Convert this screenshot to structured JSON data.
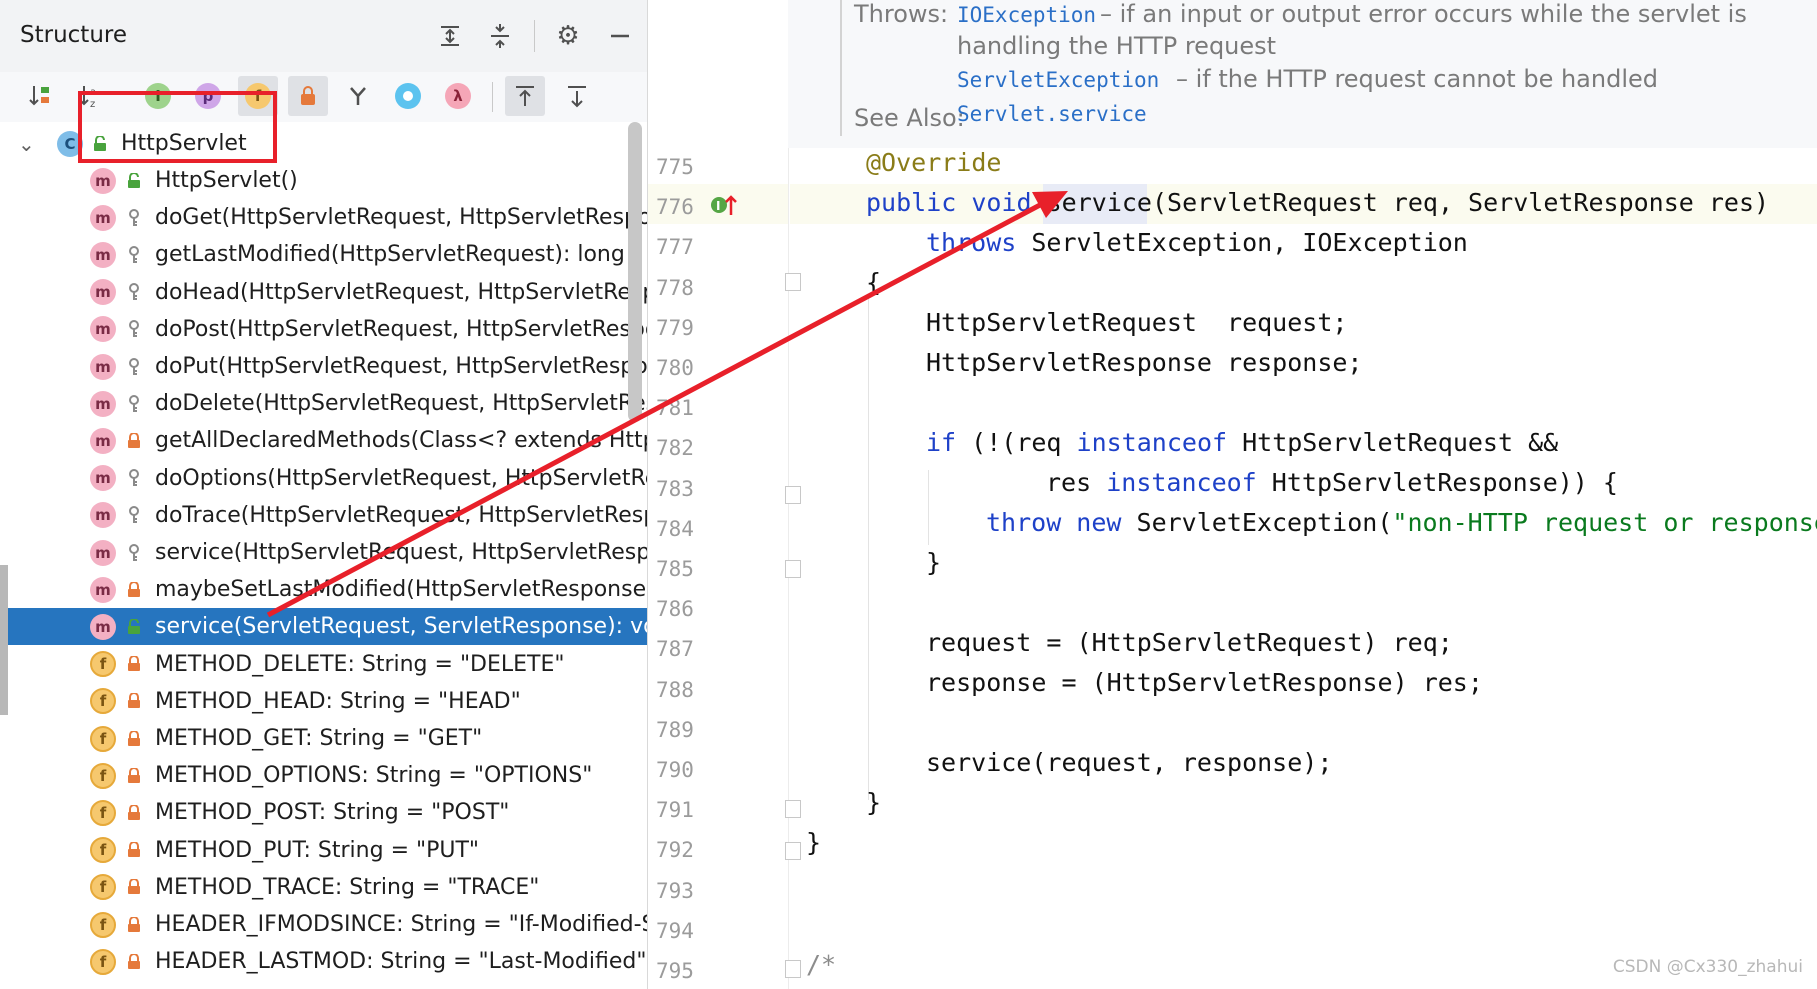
{
  "structure": {
    "title": "Structure",
    "header_icons": [
      "expand-all-icon",
      "collapse-all-icon",
      "gear-icon",
      "minimize-icon"
    ],
    "toolbar_icons": [
      "sort-by-visibility-icon",
      "sort-alphabetically-icon",
      "show-inherited-icon",
      "show-properties-icon",
      "show-fields-icon",
      "show-non-public-icon",
      "show-anonymous-icon",
      "show-lambdas-icon",
      "lambda-icon",
      "autoscroll-to-source-icon",
      "autoscroll-from-source-icon"
    ],
    "root": {
      "label": "HttpServlet",
      "kind": "C"
    },
    "items": [
      {
        "kind": "m",
        "visibility": "public",
        "label": "HttpServlet()"
      },
      {
        "kind": "m",
        "visibility": "protected",
        "label": "doGet(HttpServletRequest, HttpServletResponse)"
      },
      {
        "kind": "m",
        "visibility": "protected",
        "label": "getLastModified(HttpServletRequest): long"
      },
      {
        "kind": "m",
        "visibility": "protected",
        "label": "doHead(HttpServletRequest, HttpServletRespons"
      },
      {
        "kind": "m",
        "visibility": "protected",
        "label": "doPost(HttpServletRequest, HttpServletResponse"
      },
      {
        "kind": "m",
        "visibility": "protected",
        "label": "doPut(HttpServletRequest, HttpServletResponse)"
      },
      {
        "kind": "m",
        "visibility": "protected",
        "label": "doDelete(HttpServletRequest, HttpServletRespon"
      },
      {
        "kind": "m",
        "visibility": "private",
        "label": "getAllDeclaredMethods(Class<? extends HttpSer"
      },
      {
        "kind": "m",
        "visibility": "protected",
        "label": "doOptions(HttpServletRequest, HttpServletRespo"
      },
      {
        "kind": "m",
        "visibility": "protected",
        "label": "doTrace(HttpServletRequest, HttpServletRespons"
      },
      {
        "kind": "m",
        "visibility": "protected",
        "label": "service(HttpServletRequest, HttpServletResponse"
      },
      {
        "kind": "m",
        "visibility": "private",
        "label": "maybeSetLastModified(HttpServletResponse, lon"
      },
      {
        "kind": "m",
        "visibility": "public",
        "label": "service(ServletRequest, ServletResponse): void ↑C",
        "selected": true
      },
      {
        "kind": "f",
        "visibility": "private",
        "label": "METHOD_DELETE: String = \"DELETE\""
      },
      {
        "kind": "f",
        "visibility": "private",
        "label": "METHOD_HEAD: String = \"HEAD\""
      },
      {
        "kind": "f",
        "visibility": "private",
        "label": "METHOD_GET: String = \"GET\""
      },
      {
        "kind": "f",
        "visibility": "private",
        "label": "METHOD_OPTIONS: String = \"OPTIONS\""
      },
      {
        "kind": "f",
        "visibility": "private",
        "label": "METHOD_POST: String = \"POST\""
      },
      {
        "kind": "f",
        "visibility": "private",
        "label": "METHOD_PUT: String = \"PUT\""
      },
      {
        "kind": "f",
        "visibility": "private",
        "label": "METHOD_TRACE: String = \"TRACE\""
      },
      {
        "kind": "f",
        "visibility": "private",
        "label": "HEADER_IFMODSINCE: String = \"If-Modified-Sinc"
      },
      {
        "kind": "f",
        "visibility": "private",
        "label": "HEADER_LASTMOD: String = \"Last-Modified\""
      }
    ]
  },
  "editor": {
    "doc": {
      "throws_label": "Throws:",
      "exc1": "IOException",
      "exc1_desc": "– if an input or output error occurs while the servlet is",
      "exc1_desc2": "handling the HTTP request",
      "exc2": "ServletException",
      "exc2_desc": "– if the HTTP request cannot be handled",
      "see_also_label": "See Also:",
      "see_also_link": "Servlet.service"
    },
    "line_numbers": [
      "775",
      "776",
      "777",
      "778",
      "779",
      "780",
      "781",
      "782",
      "783",
      "784",
      "785",
      "786",
      "787",
      "788",
      "789",
      "790",
      "791",
      "792",
      "793",
      "794",
      "795"
    ],
    "code": {
      "l775": "@Override",
      "l776_kw": "public void ",
      "l776_rest": "service(ServletRequest req, ServletResponse res)",
      "l777_kw": "throws",
      "l777_rest": " ServletException, IOException",
      "l778": "{",
      "l779": "HttpServletRequest  request;",
      "l780": "HttpServletResponse response;",
      "l782_kw": "if",
      "l782_a": " (!(req ",
      "l782_kw2": "instanceof",
      "l782_b": " HttpServletRequest &&",
      "l783_a": "res ",
      "l783_kw": "instanceof",
      "l783_b": " HttpServletResponse)) {",
      "l784_kw": "throw new",
      "l784_a": " ServletException(",
      "l784_str": "\"non-HTTP request or response\"",
      "l785": "}",
      "l787": "request = (HttpServletRequest) req;",
      "l788": "response = (HttpServletResponse) res;",
      "l790": "service(request, response);",
      "l791": "}",
      "l792": "}",
      "l795": "/*"
    }
  },
  "watermark": "CSDN @Cx330_zhahui",
  "colors": {
    "selection": "#2675bf",
    "annotation_red": "#e8202a",
    "keyword": "#1e41c8",
    "string": "#0a7a1e"
  }
}
